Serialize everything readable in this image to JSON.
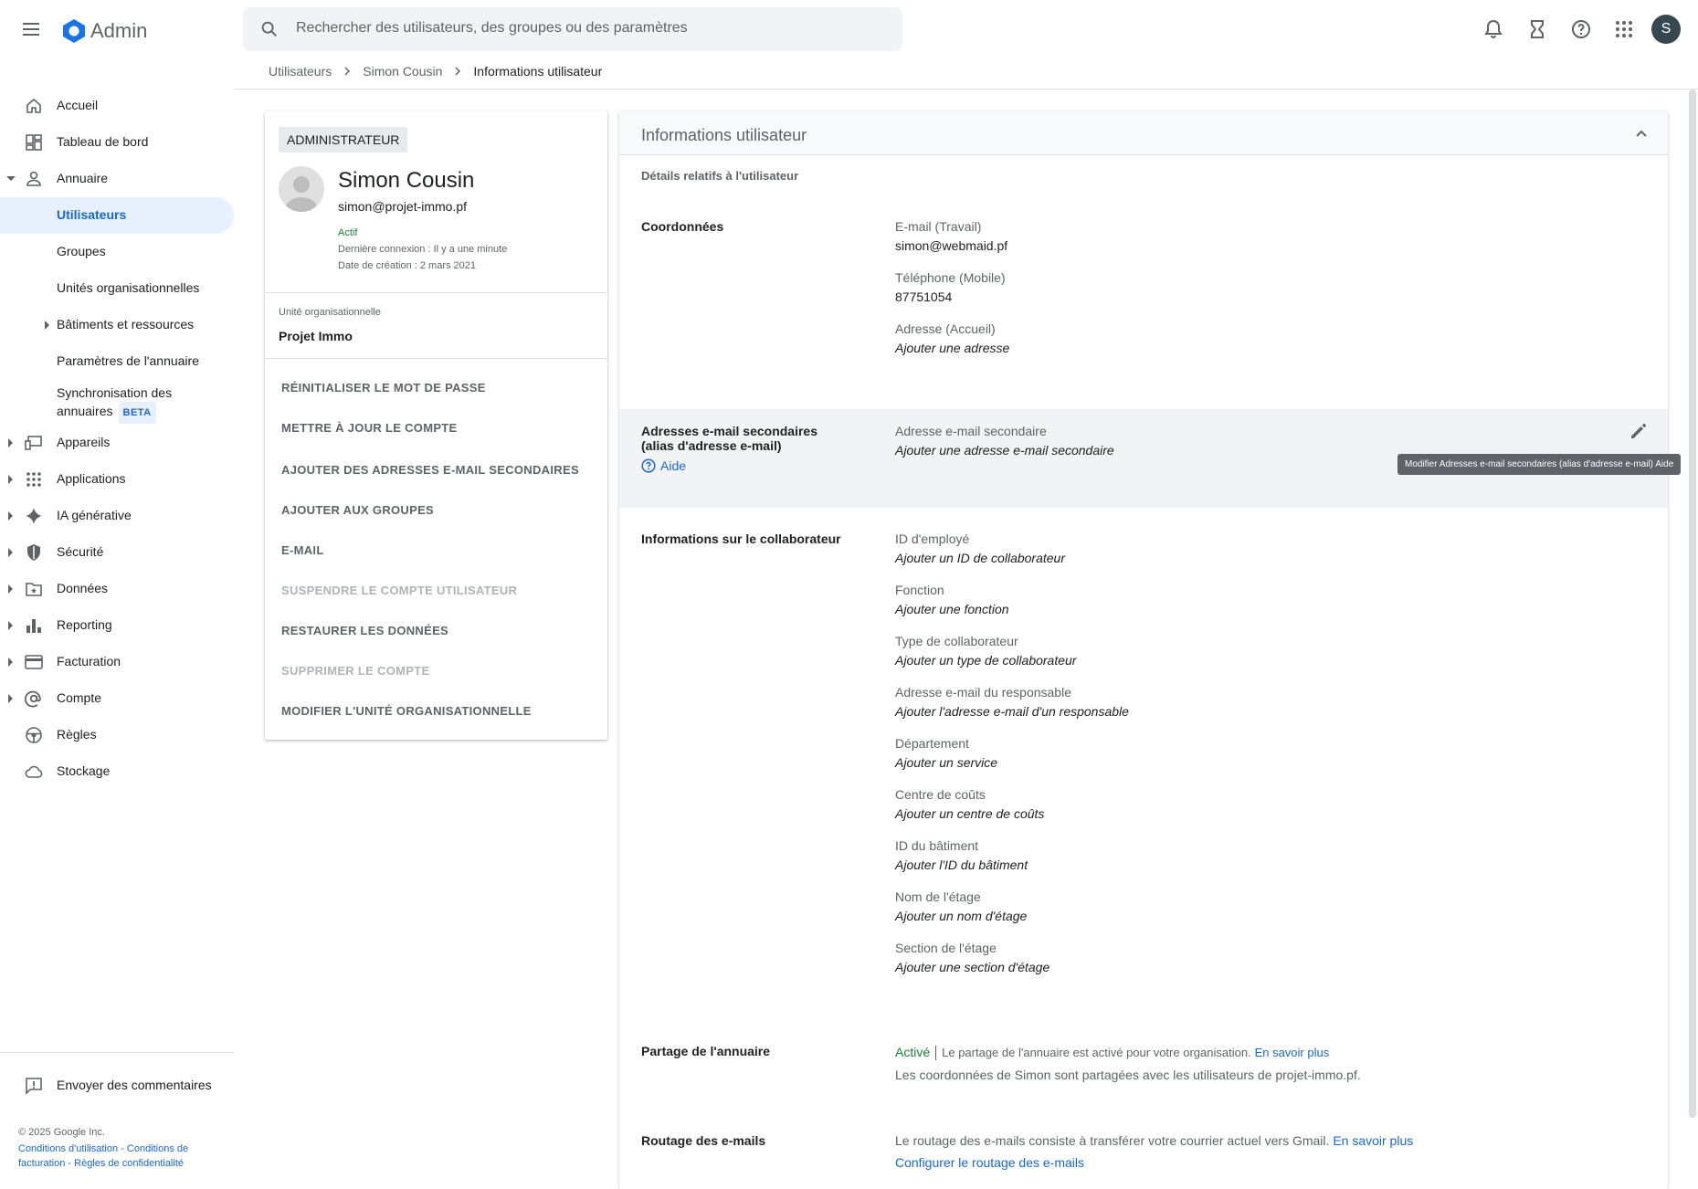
{
  "app": {
    "brand": "Admin",
    "search_placeholder": "Rechercher des utilisateurs, des groupes ou des paramètres",
    "avatar_letter": "S"
  },
  "breadcrumb": [
    "Utilisateurs",
    "Simon Cousin",
    "Informations utilisateur"
  ],
  "sidebar": {
    "items": [
      {
        "label": "Accueil",
        "icon": "home-icon"
      },
      {
        "label": "Tableau de bord",
        "icon": "dashboard-icon"
      },
      {
        "label": "Annuaire",
        "icon": "person-icon"
      },
      {
        "label": "Utilisateurs"
      },
      {
        "label": "Groupes"
      },
      {
        "label": "Unités organisationnelles"
      },
      {
        "label": "Bâtiments et ressources"
      },
      {
        "label": "Paramètres de l'annuaire"
      },
      {
        "label": "Synchronisation des annuaires",
        "badge": "BETA"
      },
      {
        "label": "Appareils",
        "icon": "devices-icon"
      },
      {
        "label": "Applications",
        "icon": "apps-icon"
      },
      {
        "label": "IA générative",
        "icon": "sparkle-icon"
      },
      {
        "label": "Sécurité",
        "icon": "shield-icon"
      },
      {
        "label": "Données",
        "icon": "folder-icon"
      },
      {
        "label": "Reporting",
        "icon": "bar-chart-icon"
      },
      {
        "label": "Facturation",
        "icon": "credit-card-icon"
      },
      {
        "label": "Compte",
        "icon": "at-sign-icon"
      },
      {
        "label": "Règles",
        "icon": "steering-icon"
      },
      {
        "label": "Stockage",
        "icon": "cloud-icon"
      }
    ],
    "feedback": "Envoyer des commentaires",
    "copyright": "© 2025 Google Inc.",
    "footer_links": "Conditions d'utilisation - Conditions de facturation - Règles de confidentialité"
  },
  "user_card": {
    "role": "ADMINISTRATEUR",
    "name": "Simon Cousin",
    "email": "simon@projet-immo.pf",
    "status": "Actif",
    "last_login": "Dernière connexion : Il y a une minute",
    "created": "Date de création : 2 mars 2021",
    "ou_label": "Unité organisationnelle",
    "ou_value": "Projet Immo",
    "actions": [
      {
        "label": "RÉINITIALISER LE MOT DE PASSE",
        "disabled": false
      },
      {
        "label": "METTRE À JOUR LE COMPTE",
        "disabled": false
      },
      {
        "label": "AJOUTER DES ADRESSES E-MAIL SECONDAIRES",
        "disabled": false
      },
      {
        "label": "AJOUTER AUX GROUPES",
        "disabled": false
      },
      {
        "label": "E-MAIL",
        "disabled": false
      },
      {
        "label": "SUSPENDRE LE COMPTE UTILISATEUR",
        "disabled": true
      },
      {
        "label": "RESTAURER LES DONNÉES",
        "disabled": false
      },
      {
        "label": "SUPPRIMER LE COMPTE",
        "disabled": true
      },
      {
        "label": "MODIFIER L'UNITÉ ORGANISATIONNELLE",
        "disabled": false
      }
    ]
  },
  "info": {
    "title": "Informations utilisateur",
    "subtitle": "Détails relatifs à l'utilisateur",
    "contact": {
      "title": "Coordonnées",
      "fields": [
        {
          "label": "E-mail (Travail)",
          "value": "simon@webmaid.pf"
        },
        {
          "label": "Téléphone (Mobile)",
          "value": "87751054"
        },
        {
          "label": "Adresse (Accueil)",
          "value": "Ajouter une adresse"
        }
      ]
    },
    "aliases": {
      "title": "Adresses e-mail secondaires (alias d'adresse e-mail)",
      "help": "Aide",
      "label": "Adresse e-mail secondaire",
      "value": "Ajouter une adresse e-mail secondaire",
      "tooltip": "Modifier Adresses e-mail secondaires (alias d'adresse e-mail) Aide"
    },
    "employee": {
      "title": "Informations sur le collaborateur",
      "fields": [
        {
          "label": "ID d'employé",
          "value": "Ajouter un ID de collaborateur"
        },
        {
          "label": "Fonction",
          "value": "Ajouter une fonction"
        },
        {
          "label": "Type de collaborateur",
          "value": "Ajouter un type de collaborateur"
        },
        {
          "label": "Adresse e-mail du responsable",
          "value": "Ajouter l'adresse e-mail d'un responsable"
        },
        {
          "label": "Département",
          "value": "Ajouter un service"
        },
        {
          "label": "Centre de coûts",
          "value": "Ajouter un centre de coûts"
        },
        {
          "label": "ID du bâtiment",
          "value": "Ajouter l'ID du bâtiment"
        },
        {
          "label": "Nom de l'étage",
          "value": "Ajouter un nom d'étage"
        },
        {
          "label": "Section de l'étage",
          "value": "Ajouter une section d'étage"
        }
      ]
    },
    "sharing": {
      "title": "Partage de l'annuaire",
      "status": "Activé",
      "desc": "Le partage de l'annuaire est activé pour votre organisation.",
      "link": "En savoir plus",
      "detail": "Les coordonnées de Simon sont partagées avec les utilisateurs de projet-immo.pf."
    },
    "routing": {
      "title": "Routage des e-mails",
      "desc": "Le routage des e-mails consiste à transférer votre courrier actuel vers Gmail.",
      "link": "En savoir plus",
      "configure": "Configurer le routage des e-mails"
    }
  }
}
